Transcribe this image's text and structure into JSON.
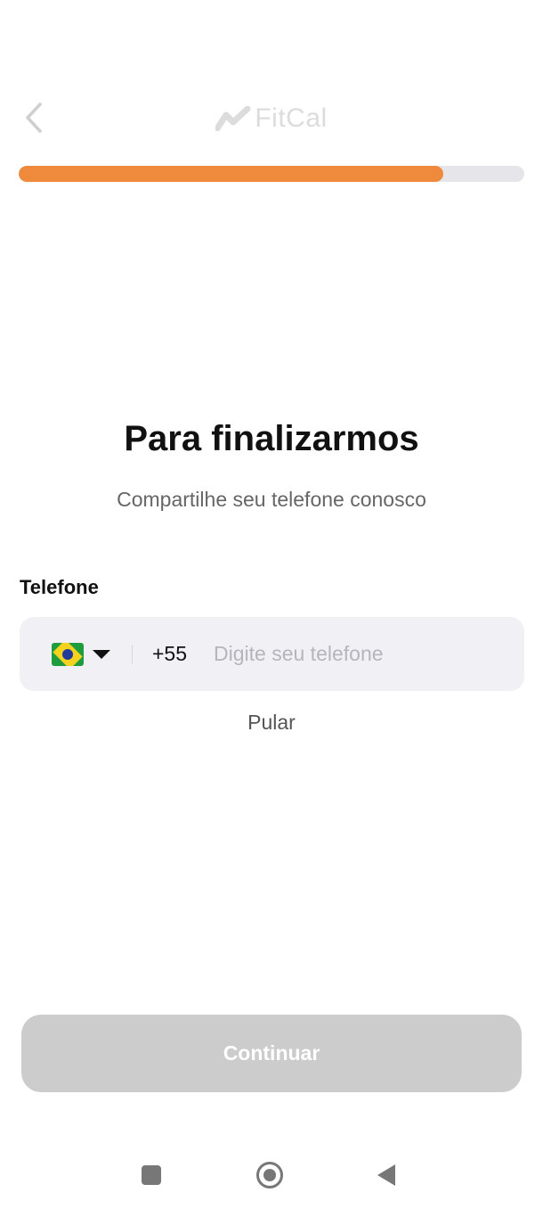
{
  "header": {
    "back_icon": "chevron-left-icon",
    "logo_icon": "trend-line-icon",
    "logo_text": "FitCal"
  },
  "progress": {
    "value_percent": 84,
    "fill_color": "#ef8a3d",
    "track_color": "#e6e6ea"
  },
  "main": {
    "title": "Para finalizarmos",
    "subtitle": "Compartilhe seu telefone conosco"
  },
  "phone": {
    "label": "Telefone",
    "country_flag": "brazil-flag-icon",
    "dropdown_icon": "caret-down-icon",
    "dial_code": "+55",
    "value": "",
    "placeholder": "Digite seu telefone"
  },
  "skip_label": "Pular",
  "continue_label": "Continuar",
  "navbar": {
    "recent_icon": "square-icon",
    "home_icon": "circle-home-icon",
    "back_icon": "triangle-back-icon"
  }
}
